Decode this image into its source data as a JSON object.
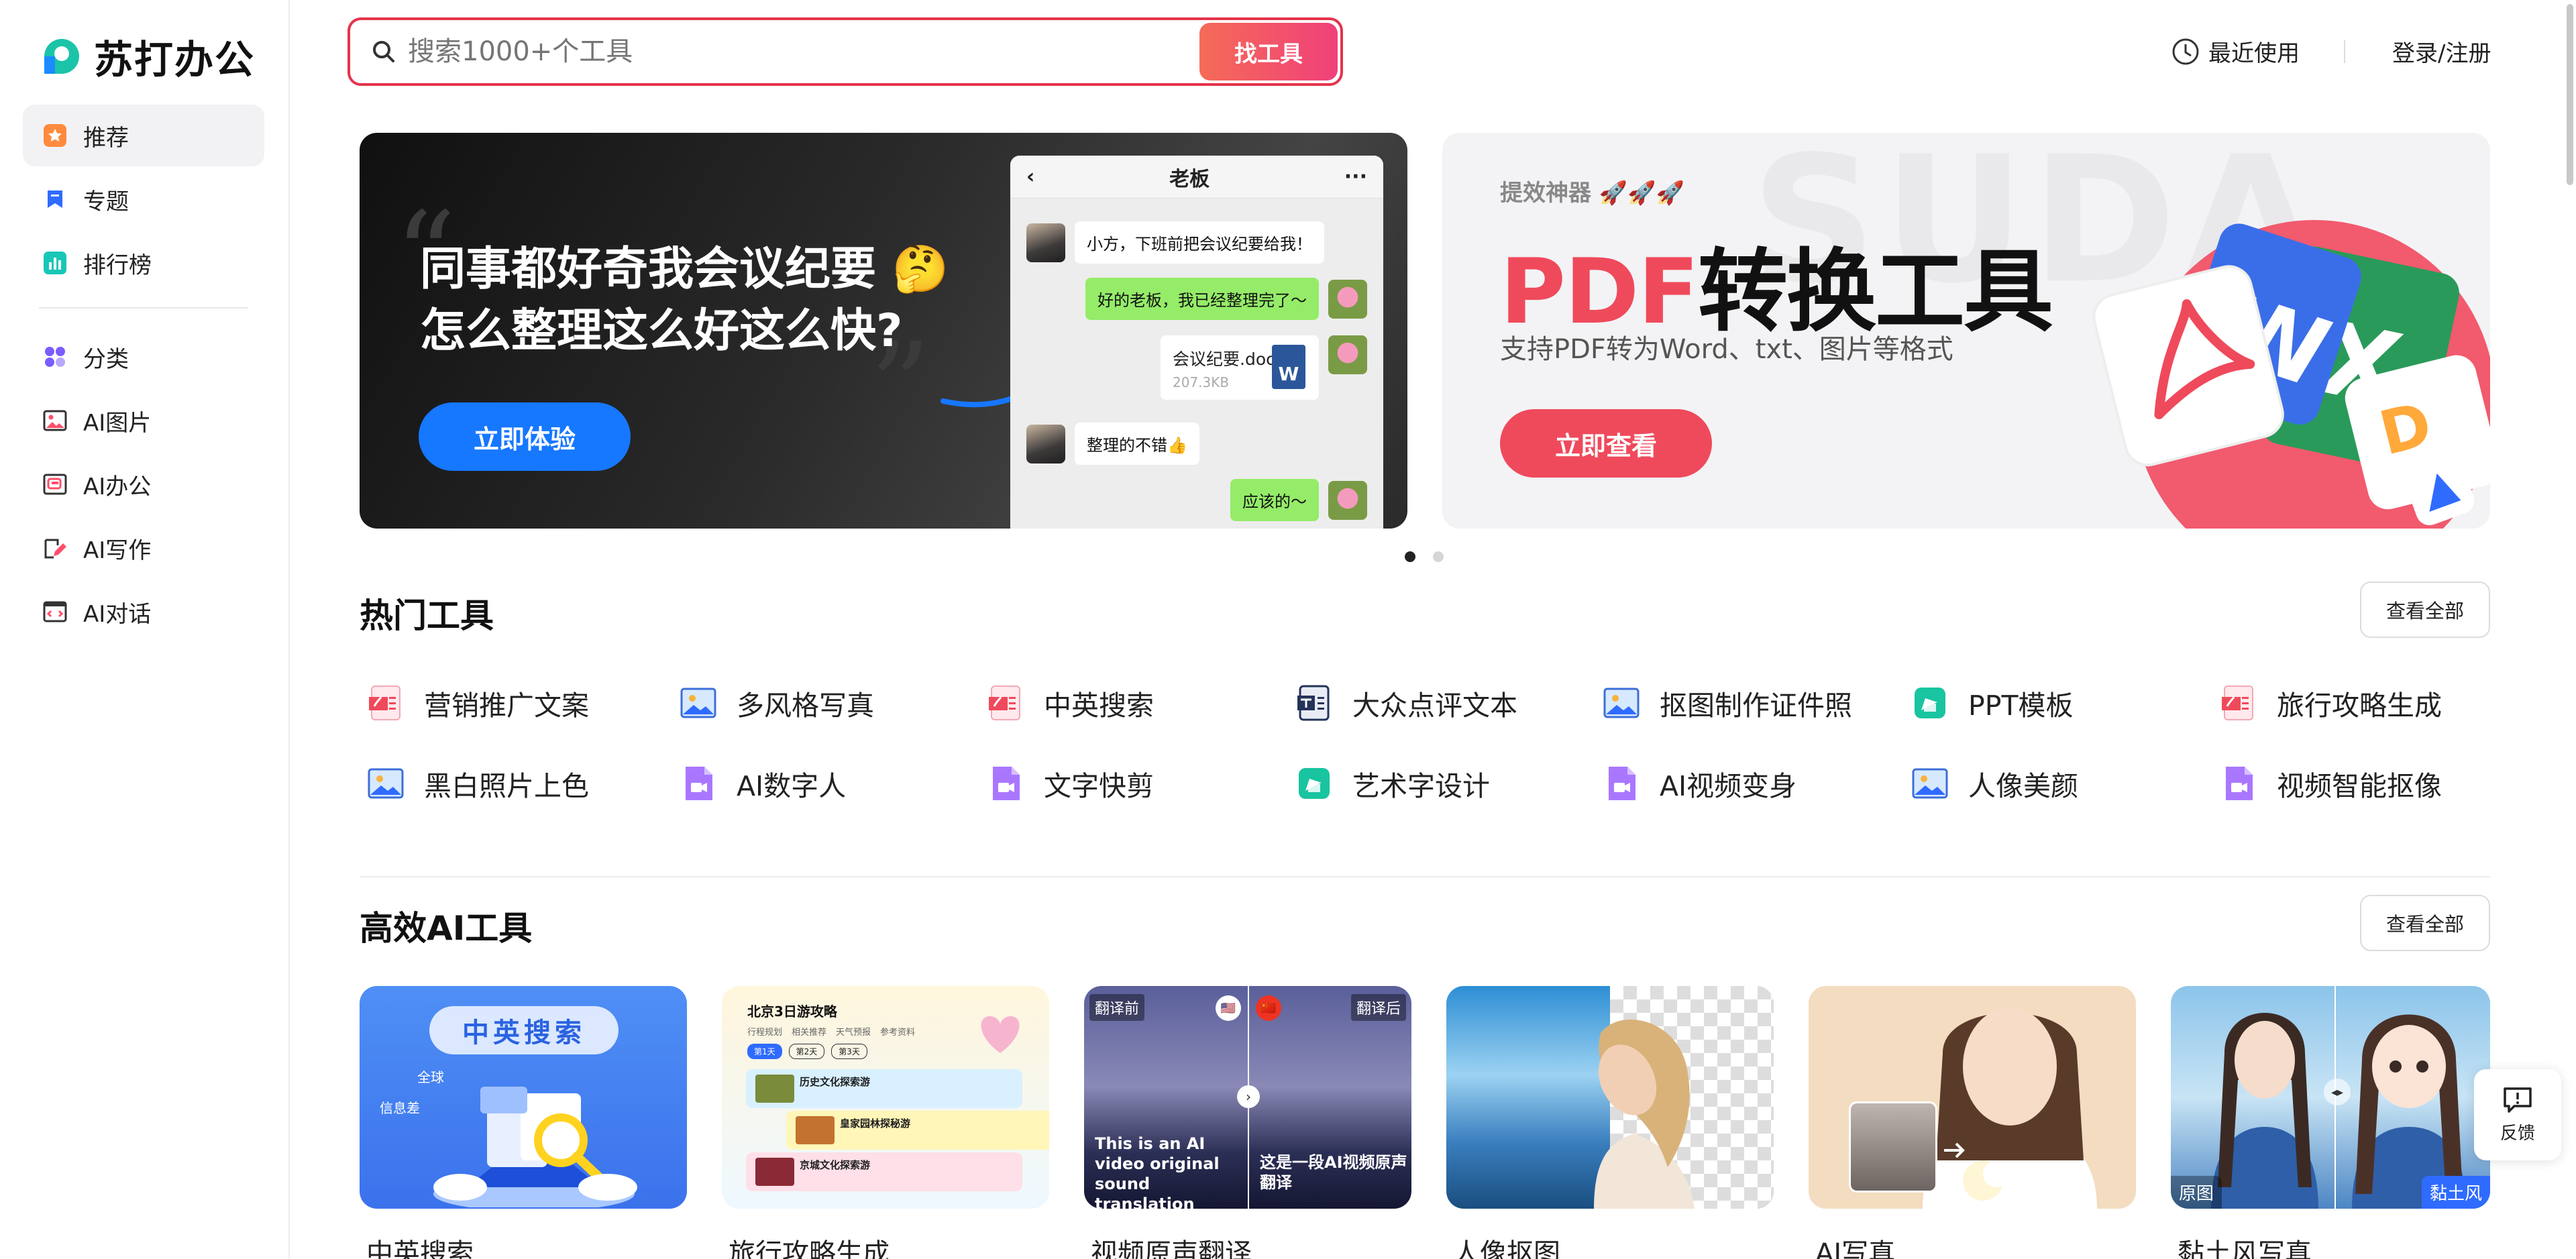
{
  "brand": {
    "name": "苏打办公"
  },
  "sidebar": {
    "items": [
      {
        "label": "推荐",
        "icon": "star-icon",
        "active": true
      },
      {
        "label": "专题",
        "icon": "bookmark-icon"
      },
      {
        "label": "排行榜",
        "icon": "ranking-icon"
      },
      {
        "label": "分类",
        "icon": "category-icon"
      },
      {
        "label": "AI图片",
        "icon": "image-icon"
      },
      {
        "label": "AI办公",
        "icon": "office-icon"
      },
      {
        "label": "AI写作",
        "icon": "pen-icon"
      },
      {
        "label": "AI对话",
        "icon": "chat-icon"
      }
    ]
  },
  "search": {
    "placeholder": "搜索1000+个工具",
    "button": "找工具"
  },
  "header": {
    "recent": "最近使用",
    "login": "登录/注册"
  },
  "banner1": {
    "title_line1": "同事都好奇我会议纪要 🤔",
    "title_line2": "怎么整理这么好这么快?",
    "button": "立即体验",
    "chat": {
      "title": "老板",
      "m1": "小方，下班前把会议纪要给我！",
      "m2": "好的老板，我已经整理完了～",
      "file_name": "会议纪要.docx",
      "file_size": "207.3KB",
      "file_badge": "W",
      "m3": "整理的不错👍",
      "m4": "应该的～"
    }
  },
  "banner2": {
    "tag": "提效神器 🚀🚀🚀",
    "title_pdf": "PDF",
    "title_rest": "转换工具",
    "subtitle": "支持PDF转为Word、txt、图片等格式",
    "button": "立即查看",
    "watermark": "SUDA"
  },
  "hot_tools": {
    "title": "热门工具",
    "view_all": "查看全部",
    "items": [
      {
        "label": "营销推广文案",
        "icon": "pdf-doc-icon"
      },
      {
        "label": "多风格写真",
        "icon": "picture-icon"
      },
      {
        "label": "中英搜索",
        "icon": "pdf-doc-icon"
      },
      {
        "label": "大众点评文本",
        "icon": "text-doc-icon"
      },
      {
        "label": "抠图制作证件照",
        "icon": "picture-icon"
      },
      {
        "label": "PPT模板",
        "icon": "ppt-icon"
      },
      {
        "label": "旅行攻略生成",
        "icon": "pdf-doc-icon"
      },
      {
        "label": "黑白照片上色",
        "icon": "picture-icon"
      },
      {
        "label": "AI数字人",
        "icon": "video-doc-icon"
      },
      {
        "label": "文字快剪",
        "icon": "video-doc-icon"
      },
      {
        "label": "艺术字设计",
        "icon": "ppt-icon"
      },
      {
        "label": "AI视频变身",
        "icon": "video-doc-icon"
      },
      {
        "label": "人像美颜",
        "icon": "picture-icon"
      },
      {
        "label": "视频智能抠像",
        "icon": "video-doc-icon"
      }
    ]
  },
  "ai_tools": {
    "title": "高效AI工具",
    "view_all": "查看全部",
    "cards": [
      {
        "label": "中英搜索",
        "badge": "中英搜索",
        "tag1": "全球",
        "tag2": "信息差"
      },
      {
        "label": "旅行攻略生成",
        "heading": "北京3日游攻略",
        "tabs": [
          "行程规划",
          "相关推荐",
          "天气预报",
          "参考资料"
        ],
        "days": [
          "第1天",
          "第2天",
          "第3天"
        ],
        "spots": [
          "历史文化探索游",
          "皇家园林探秘游",
          "京城文化探索游"
        ]
      },
      {
        "label": "视频原声翻译",
        "before": "翻译前",
        "after": "翻译后",
        "en": "This is an AI video original sound translation",
        "zh": "这是一段AI视频原声翻译"
      },
      {
        "label": "人像抠图"
      },
      {
        "label": "AI写真"
      },
      {
        "label": "黏土风写真",
        "left": "原图",
        "right": "黏土风"
      }
    ]
  },
  "feedback": {
    "label": "反馈"
  }
}
